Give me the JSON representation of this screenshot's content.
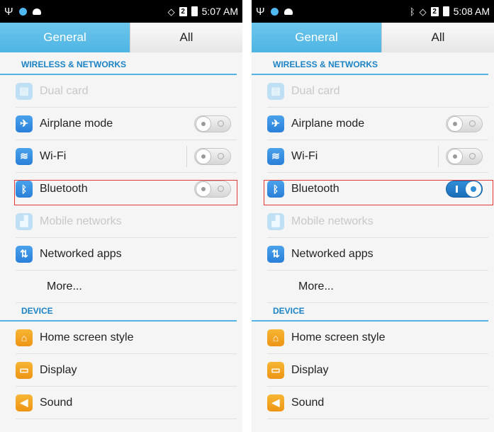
{
  "screens": [
    {
      "status": {
        "time": "5:07 AM",
        "sim": "2"
      },
      "tabs": {
        "general": "General",
        "all": "All"
      },
      "sections": {
        "wireless": "WIRELESS & NETWORKS",
        "device": "DEVICE"
      },
      "items": {
        "dual_card": "Dual card",
        "airplane": "Airplane mode",
        "wifi": "Wi-Fi",
        "bluetooth": "Bluetooth",
        "mobile_networks": "Mobile networks",
        "networked_apps": "Networked apps",
        "more": "More...",
        "home_screen_style": "Home screen style",
        "display": "Display",
        "sound": "Sound"
      },
      "toggles": {
        "airplane": "off",
        "wifi": "off",
        "bluetooth": "off"
      }
    },
    {
      "status": {
        "time": "5:08 AM",
        "sim": "2"
      },
      "tabs": {
        "general": "General",
        "all": "All"
      },
      "sections": {
        "wireless": "WIRELESS & NETWORKS",
        "device": "DEVICE"
      },
      "items": {
        "dual_card": "Dual card",
        "airplane": "Airplane mode",
        "wifi": "Wi-Fi",
        "bluetooth": "Bluetooth",
        "mobile_networks": "Mobile networks",
        "networked_apps": "Networked apps",
        "more": "More...",
        "home_screen_style": "Home screen style",
        "display": "Display",
        "sound": "Sound"
      },
      "toggles": {
        "airplane": "off",
        "wifi": "off",
        "bluetooth": "on"
      }
    }
  ],
  "colors": {
    "accent": "#4fb4e3",
    "highlight": "#e53935",
    "toggle_on": "#2f8ed6"
  }
}
